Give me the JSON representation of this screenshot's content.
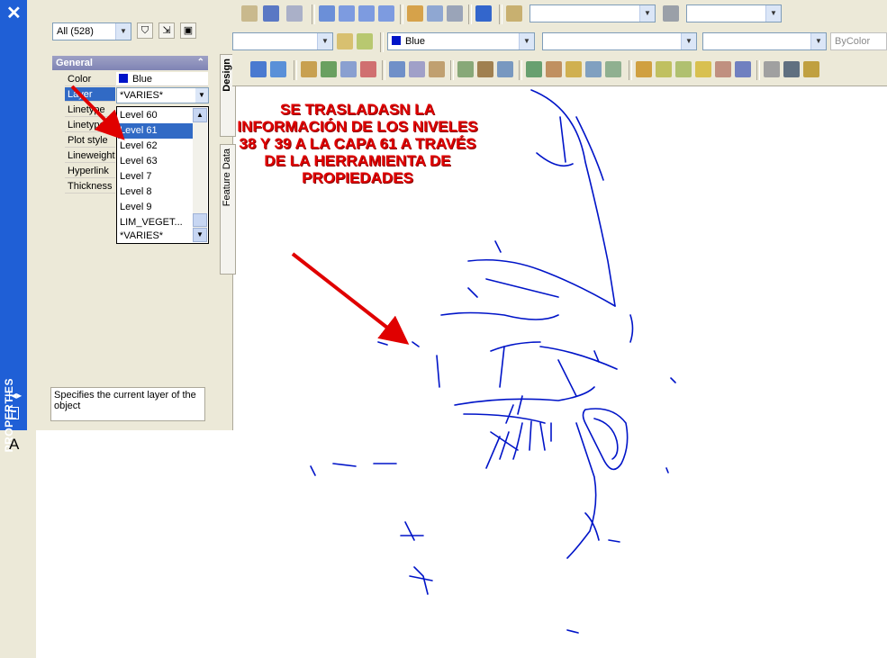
{
  "properties_palette": {
    "title": "PROPERTIES",
    "selection": "All (528)",
    "section": "General",
    "rows": [
      {
        "name": "Color",
        "value": "Blue"
      },
      {
        "name": "Layer",
        "value": "*VARIES*"
      },
      {
        "name": "Linetype",
        "value": ""
      },
      {
        "name": "Linetype",
        "value": ""
      },
      {
        "name": "Plot style",
        "value": ""
      },
      {
        "name": "Lineweight",
        "value": ""
      },
      {
        "name": "Hyperlink",
        "value": ""
      },
      {
        "name": "Thickness",
        "value": ""
      }
    ],
    "layer_list": [
      "Level 60",
      "Level 61",
      "Level 62",
      "Level 63",
      "Level 7",
      "Level 8",
      "Level 9",
      "LIM_VEGET...",
      "*VARIES*"
    ],
    "selected_layer": "Level 61",
    "description": "Specifies the current layer of the object",
    "tabs": [
      "Design",
      "Feature Data"
    ]
  },
  "toolbar": {
    "color_combo": "Blue",
    "bycolor": "ByColor"
  },
  "left_tools": {
    "text_tool": "A"
  },
  "annotation": {
    "text": "SE TRASLADASN LA INFORMACIÓN DE LOS NIVELES 38 Y 39 A LA CAPA 61 A TRAVÉS DE LA HERRAMIENTA DE PROPIEDADES",
    "color": "#e00000"
  },
  "colors": {
    "title_bar": "#1f5fd6",
    "selection": "#316ac5",
    "drawing_lines": "#0014c8",
    "panel_bg": "#ece9d8"
  }
}
